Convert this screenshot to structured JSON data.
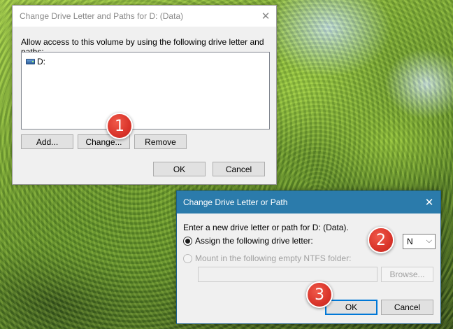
{
  "dialog_main": {
    "title": "Change Drive Letter and Paths for D: (Data)",
    "close_glyph": "✕",
    "description": "Allow access to this volume by using the following drive letter and paths:",
    "list_items": [
      {
        "icon": "drive-icon",
        "label": "D:"
      }
    ],
    "buttons": {
      "add": "Add...",
      "change": "Change...",
      "remove": "Remove",
      "ok": "OK",
      "cancel": "Cancel"
    }
  },
  "dialog_change": {
    "title": "Change Drive Letter or Path",
    "close_glyph": "✕",
    "prompt": "Enter a new drive letter or path for D: (Data).",
    "option_assign": "Assign the following drive letter:",
    "option_mount": "Mount in the following empty NTFS folder:",
    "selected_letter": "N",
    "chevron": "⌵",
    "buttons": {
      "browse": "Browse...",
      "ok": "OK",
      "cancel": "Cancel"
    }
  },
  "annotations": [
    "1",
    "2",
    "3"
  ]
}
